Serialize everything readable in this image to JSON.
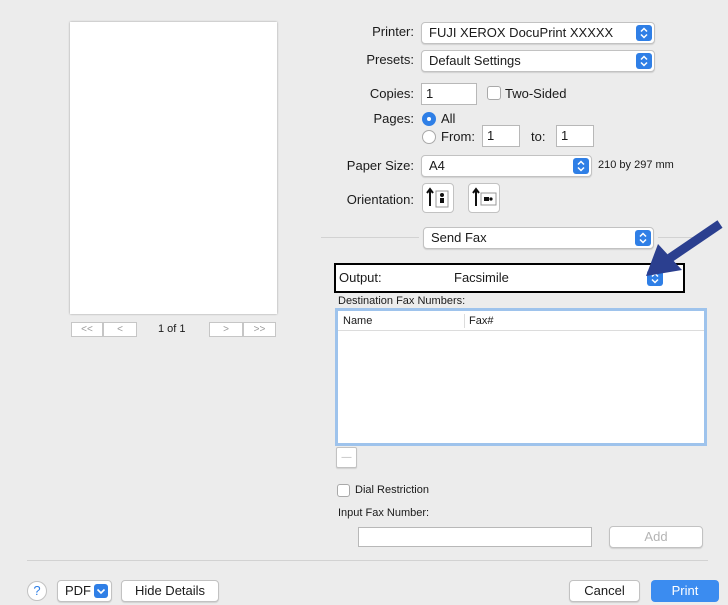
{
  "printer": {
    "label": "Printer:",
    "value": "FUJI XEROX DocuPrint XXXXX"
  },
  "presets": {
    "label": "Presets:",
    "value": "Default Settings"
  },
  "copies": {
    "label": "Copies:",
    "value": "1",
    "two_sided_label": "Two-Sided"
  },
  "pages": {
    "label": "Pages:",
    "all_label": "All",
    "from_label": "From:",
    "from_value": "1",
    "to_label": "to:",
    "to_value": "1"
  },
  "paper_size": {
    "label": "Paper Size:",
    "value": "A4",
    "dimensions": "210 by 297 mm"
  },
  "orientation": {
    "label": "Orientation:"
  },
  "section_popup": {
    "value": "Send Fax"
  },
  "output": {
    "label": "Output:",
    "value": "Facsimile"
  },
  "destination": {
    "label": "Destination Fax Numbers:",
    "columns": [
      "Name",
      "Fax#"
    ],
    "remove_label": "—"
  },
  "dial_restriction_label": "Dial Restriction",
  "input_fax": {
    "label": "Input Fax Number:",
    "value": "",
    "add_label": "Add"
  },
  "preview": {
    "page_indicator": "1 of 1",
    "first": "<<",
    "prev": "<",
    "next": ">",
    "last": ">>"
  },
  "footer": {
    "help": "?",
    "pdf": "PDF",
    "hide_details": "Hide Details",
    "cancel": "Cancel",
    "print": "Print"
  },
  "colors": {
    "accent": "#2f7fe6",
    "annotation_arrow": "#2b3f8f"
  }
}
